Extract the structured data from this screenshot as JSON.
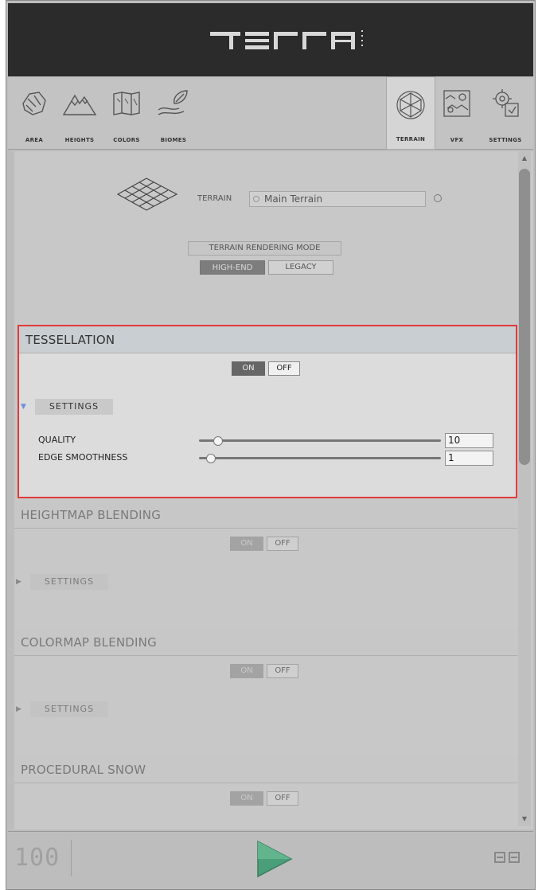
{
  "app": {
    "logo_text": "ΤΞΓΓΛ"
  },
  "toolbar": {
    "left_tools": [
      {
        "label": "AREA",
        "icon": "area-icon"
      },
      {
        "label": "HEIGHTS",
        "icon": "mountain-icon"
      },
      {
        "label": "COLORS",
        "icon": "map-icon"
      },
      {
        "label": "BIOMES",
        "icon": "leaf-hand-icon"
      }
    ],
    "right_tools": [
      {
        "label": "TERRAIN",
        "icon": "sphere-icon",
        "active": true
      },
      {
        "label": "VFX",
        "icon": "vfx-icon"
      },
      {
        "label": "SETTINGS",
        "icon": "settings-icon"
      }
    ]
  },
  "terrain": {
    "label": "TERRAIN",
    "value": "Main Terrain"
  },
  "rendering": {
    "mode_label": "TERRAIN RENDERING MODE",
    "highend_label": "HIGH-END",
    "legacy_label": "LEGACY"
  },
  "sections": {
    "tessellation": {
      "title": "TESSELLATION",
      "on": "ON",
      "off": "OFF",
      "settings": "SETTINGS",
      "quality_label": "QUALITY",
      "quality_value": "10",
      "quality_fraction": 0.08,
      "edge_label": "EDGE SMOOTHNESS",
      "edge_value": "1",
      "edge_fraction": 0.05
    },
    "heightmap": {
      "title": "HEIGHTMAP BLENDING",
      "on": "ON",
      "off": "OFF",
      "settings": "SETTINGS"
    },
    "colormap": {
      "title": "COLORMAP BLENDING",
      "on": "ON",
      "off": "OFF",
      "settings": "SETTINGS"
    },
    "snow": {
      "title": "PROCEDURAL SNOW",
      "on": "ON",
      "off": "OFF"
    }
  },
  "bottom": {
    "counter": "100"
  },
  "colors": {
    "highlight_border": "#e03a3a",
    "dark_header": "#2b2b2b",
    "play_green": "#4a9f7a"
  }
}
